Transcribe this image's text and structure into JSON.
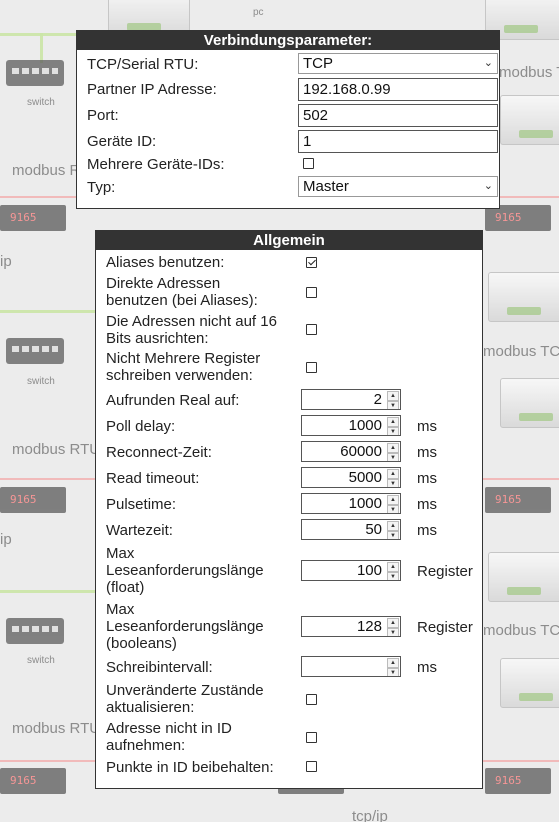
{
  "background": {
    "labels": [
      "pc",
      "switch",
      "switch",
      "switch",
      "modbus RTU",
      "modbus RTU",
      "modbus RTU",
      "modbus TCP",
      "modbus TCP",
      "modbus TCP",
      "ip",
      "ip",
      "tcp/ip"
    ]
  },
  "connection": {
    "title": "Verbindungsparameter:",
    "fields": {
      "protocol_label": "TCP/Serial RTU:",
      "protocol_value": "TCP",
      "partner_ip_label": "Partner IP Adresse:",
      "partner_ip_value": "192.168.0.99",
      "port_label": "Port:",
      "port_value": "502",
      "device_id_label": "Geräte ID:",
      "device_id_value": "1",
      "multi_ids_label": "Mehrere Geräte-IDs:",
      "multi_ids_checked": false,
      "type_label": "Typ:",
      "type_value": "Master"
    }
  },
  "general": {
    "title": "Allgemein",
    "aliases_label": "Aliases benutzen:",
    "aliases_checked": true,
    "direct_addr_label_1": "Direkte Adressen",
    "direct_addr_label_2": "benutzen (bei Aliases):",
    "direct_addr_checked": false,
    "no_align_label_1": "Die Adressen nicht auf 16",
    "no_align_label_2": "Bits ausrichten:",
    "no_align_checked": false,
    "no_multi_write_label_1": "Nicht Mehrere Register",
    "no_multi_write_label_2": "schreiben verwenden:",
    "no_multi_write_checked": false,
    "round_real_label": "Aufrunden Real auf:",
    "round_real_value": "2",
    "poll_delay_label": "Poll delay:",
    "poll_delay_value": "1000",
    "poll_delay_unit": "ms",
    "reconnect_label": "Reconnect-Zeit:",
    "reconnect_value": "60000",
    "reconnect_unit": "ms",
    "read_timeout_label": "Read timeout:",
    "read_timeout_value": "5000",
    "read_timeout_unit": "ms",
    "pulsetime_label": "Pulsetime:",
    "pulsetime_value": "1000",
    "pulsetime_unit": "ms",
    "wait_label": "Wartezeit:",
    "wait_value": "50",
    "wait_unit": "ms",
    "max_float_label_1": "Max",
    "max_float_label_2": "Leseanforderungslänge",
    "max_float_label_3": "(float)",
    "max_float_value": "100",
    "max_float_unit": "Register",
    "max_bool_label_1": "Max",
    "max_bool_label_2": "Leseanforderungslänge",
    "max_bool_label_3": "(booleans)",
    "max_bool_value": "128",
    "max_bool_unit": "Register",
    "write_interval_label": "Schreibintervall:",
    "write_interval_value": "",
    "write_interval_unit": "ms",
    "update_unchanged_label_1": "Unveränderte Zustände",
    "update_unchanged_label_2": "aktualisieren:",
    "update_unchanged_checked": false,
    "addr_not_in_id_label_1": "Adresse nicht in ID",
    "addr_not_in_id_label_2": "aufnehmen:",
    "addr_not_in_id_checked": false,
    "keep_points_label": "Punkte in ID beibehalten:",
    "keep_points_checked": false
  }
}
